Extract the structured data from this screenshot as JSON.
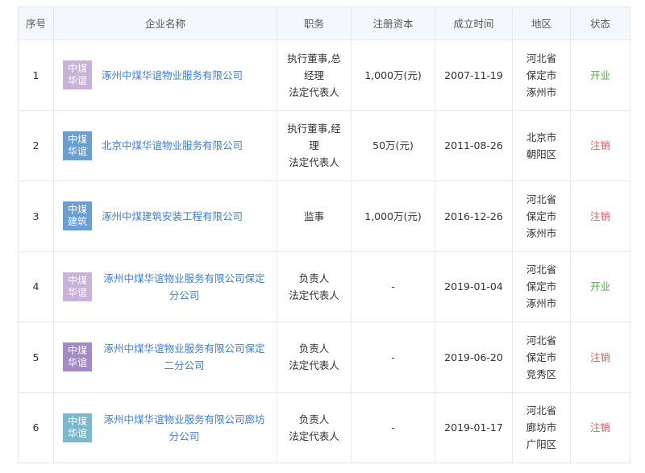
{
  "table": {
    "headers": {
      "no": "序号",
      "name": "企业名称",
      "role": "职务",
      "capital": "注册资本",
      "date": "成立时间",
      "area": "地区",
      "status": "状态"
    },
    "rows": [
      {
        "no": "1",
        "logo": [
          "中煤",
          "华谊"
        ],
        "logo_color": "#c9b1d9",
        "name": "涿州中煤华谊物业服务有限公司",
        "role": [
          "执行董事,总",
          "经理",
          "法定代表人"
        ],
        "capital": "1,000万(元)",
        "date": "2007-11-19",
        "area": [
          "河北省",
          "保定市",
          "涿州市"
        ],
        "status": "开业",
        "status_color": "#52a84a"
      },
      {
        "no": "2",
        "logo": [
          "中煤",
          "华谊"
        ],
        "logo_color": "#6a9fd4",
        "name": "北京中煤华谊物业服务有限公司",
        "role": [
          "执行董事,经",
          "理",
          "法定代表人"
        ],
        "capital": "50万(元)",
        "date": "2011-08-26",
        "area": [
          "北京市",
          "朝阳区"
        ],
        "status": "注销",
        "status_color": "#e45e5e"
      },
      {
        "no": "3",
        "logo": [
          "中煤",
          "建筑"
        ],
        "logo_color": "#6a9fd4",
        "name": "涿州中煤建筑安装工程有限公司",
        "role": [
          "监事"
        ],
        "capital": "1,000万(元)",
        "date": "2016-12-26",
        "area": [
          "河北省",
          "保定市",
          "涿州市"
        ],
        "status": "注销",
        "status_color": "#e45e5e"
      },
      {
        "no": "4",
        "logo": [
          "中煤",
          "华谊"
        ],
        "logo_color": "#c9b1d9",
        "name": "涿州中煤华谊物业服务有限公司保定分公司",
        "role": [
          "负责人",
          "法定代表人"
        ],
        "capital": "-",
        "date": "2019-01-04",
        "area": [
          "河北省",
          "保定市",
          "涿州市"
        ],
        "status": "开业",
        "status_color": "#52a84a"
      },
      {
        "no": "5",
        "logo": [
          "中煤",
          "华谊"
        ],
        "logo_color": "#a68ac6",
        "name": "涿州中煤华谊物业服务有限公司保定二分公司",
        "role": [
          "负责人",
          "法定代表人"
        ],
        "capital": "-",
        "date": "2019-06-20",
        "area": [
          "河北省",
          "保定市",
          "竞秀区"
        ],
        "status": "注销",
        "status_color": "#e45e5e"
      },
      {
        "no": "6",
        "logo": [
          "中煤",
          "华谊"
        ],
        "logo_color": "#7bb8cf",
        "name": "涿州中煤华谊物业服务有限公司廊坊分公司",
        "role": [
          "负责人",
          "法定代表人"
        ],
        "capital": "-",
        "date": "2019-01-17",
        "area": [
          "河北省",
          "廊坊市",
          "广阳区"
        ],
        "status": "注销",
        "status_color": "#e45e5e"
      }
    ]
  }
}
